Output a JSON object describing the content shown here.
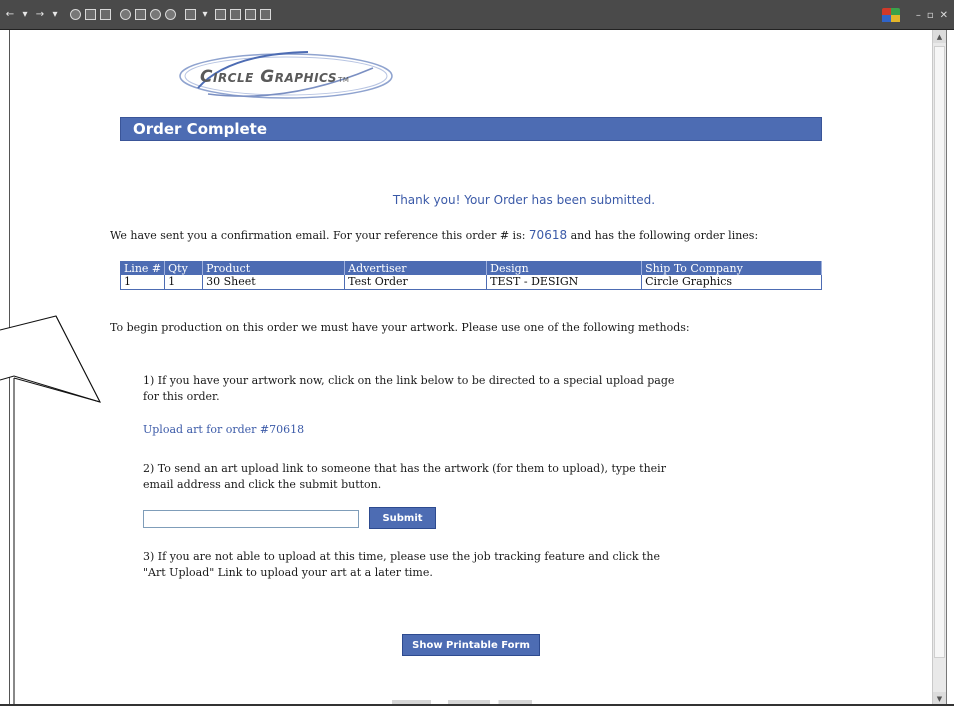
{
  "brand": {
    "name": "Circle Graphics",
    "tm": "TM"
  },
  "header": {
    "title": "Order Complete"
  },
  "messages": {
    "thank_you": "Thank you! Your Order has been submitted.",
    "confirm_prefix": "We have sent you a confirmation email. For your reference this order # is:",
    "order_number": "70618",
    "confirm_suffix": "and has the following order lines:",
    "production": "To begin production on this order we must have your artwork. Please use one of the following methods:"
  },
  "order_table": {
    "columns": [
      "Line #",
      "Qty",
      "Product",
      "Advertiser",
      "Design",
      "Ship To Company"
    ],
    "rows": [
      [
        "1",
        "1",
        "30 Sheet",
        "Test Order",
        "TEST - DESIGN",
        "Circle Graphics"
      ]
    ]
  },
  "steps": {
    "step1": "1) If you have your artwork now, click on the link below to be directed to a special upload page for this order.",
    "upload_link": "Upload art for order #70618",
    "step2": "2) To send an art upload link to someone that has the artwork (for them to upload), type their email address and click the submit button.",
    "email_value": "",
    "submit_label": "Submit",
    "step3": "3) If you are not able to upload at this time, please use the job tracking feature and click the \"Art Upload\" Link to upload your art at a later time."
  },
  "actions": {
    "printable_label": "Show Printable Form"
  },
  "colors": {
    "accent": "#4d6cb3",
    "link": "#3b5aa8"
  },
  "icons": {
    "toolbar": [
      "back-icon",
      "forward-icon",
      "stop-icon",
      "refresh-icon",
      "home-icon",
      "search-icon",
      "favorites-icon",
      "history-icon",
      "mail-icon",
      "print-icon",
      "edit-icon",
      "discuss-icon",
      "messenger-icon"
    ],
    "window": [
      "windows-logo-icon",
      "minimize-icon",
      "restore-icon",
      "close-icon"
    ]
  }
}
